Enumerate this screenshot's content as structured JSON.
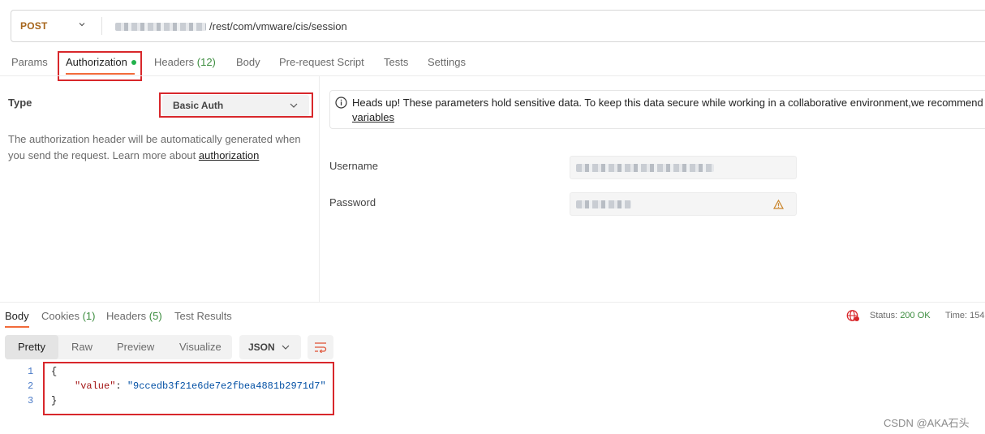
{
  "request": {
    "method": "POST",
    "url_path": "/rest/com/vmware/cis/session"
  },
  "tabs": [
    {
      "label": "Params"
    },
    {
      "label": "Authorization",
      "indicator": "green-dot"
    },
    {
      "label": "Headers",
      "count": "(12)"
    },
    {
      "label": "Body"
    },
    {
      "label": "Pre-request Script"
    },
    {
      "label": "Tests"
    },
    {
      "label": "Settings"
    }
  ],
  "auth": {
    "type_label": "Type",
    "type_value": "Basic Auth",
    "description_prefix": "The authorization header will be automatically generated when you send the request. Learn more about ",
    "description_link": "authorization",
    "notice_prefix": "Heads up! These parameters hold sensitive data. To keep this data secure while working in a collaborative environment,we recommend us",
    "notice_link": "variables",
    "username_label": "Username",
    "password_label": "Password"
  },
  "response": {
    "tabs": [
      {
        "label": "Body"
      },
      {
        "label": "Cookies",
        "count": "(1)"
      },
      {
        "label": "Headers",
        "count": "(5)"
      },
      {
        "label": "Test Results"
      }
    ],
    "status_label": "Status:",
    "status_value": "200 OK",
    "time_label": "Time:",
    "time_value": "154",
    "view_modes": [
      "Pretty",
      "Raw",
      "Preview",
      "Visualize"
    ],
    "format": "JSON",
    "lines": [
      "1",
      "2",
      "3"
    ],
    "json_open": "{",
    "json_key": "\"value\"",
    "json_colon": ": ",
    "json_value": "\"9ccedb3f21e6de7e2fbea4881b2971d7\"",
    "json_close": "}"
  },
  "watermark": "CSDN @AKA石头",
  "colors": {
    "accent": "#f26b3a",
    "highlight": "#d8272b",
    "ok": "#3c8d3f",
    "method": "#a6651b"
  }
}
